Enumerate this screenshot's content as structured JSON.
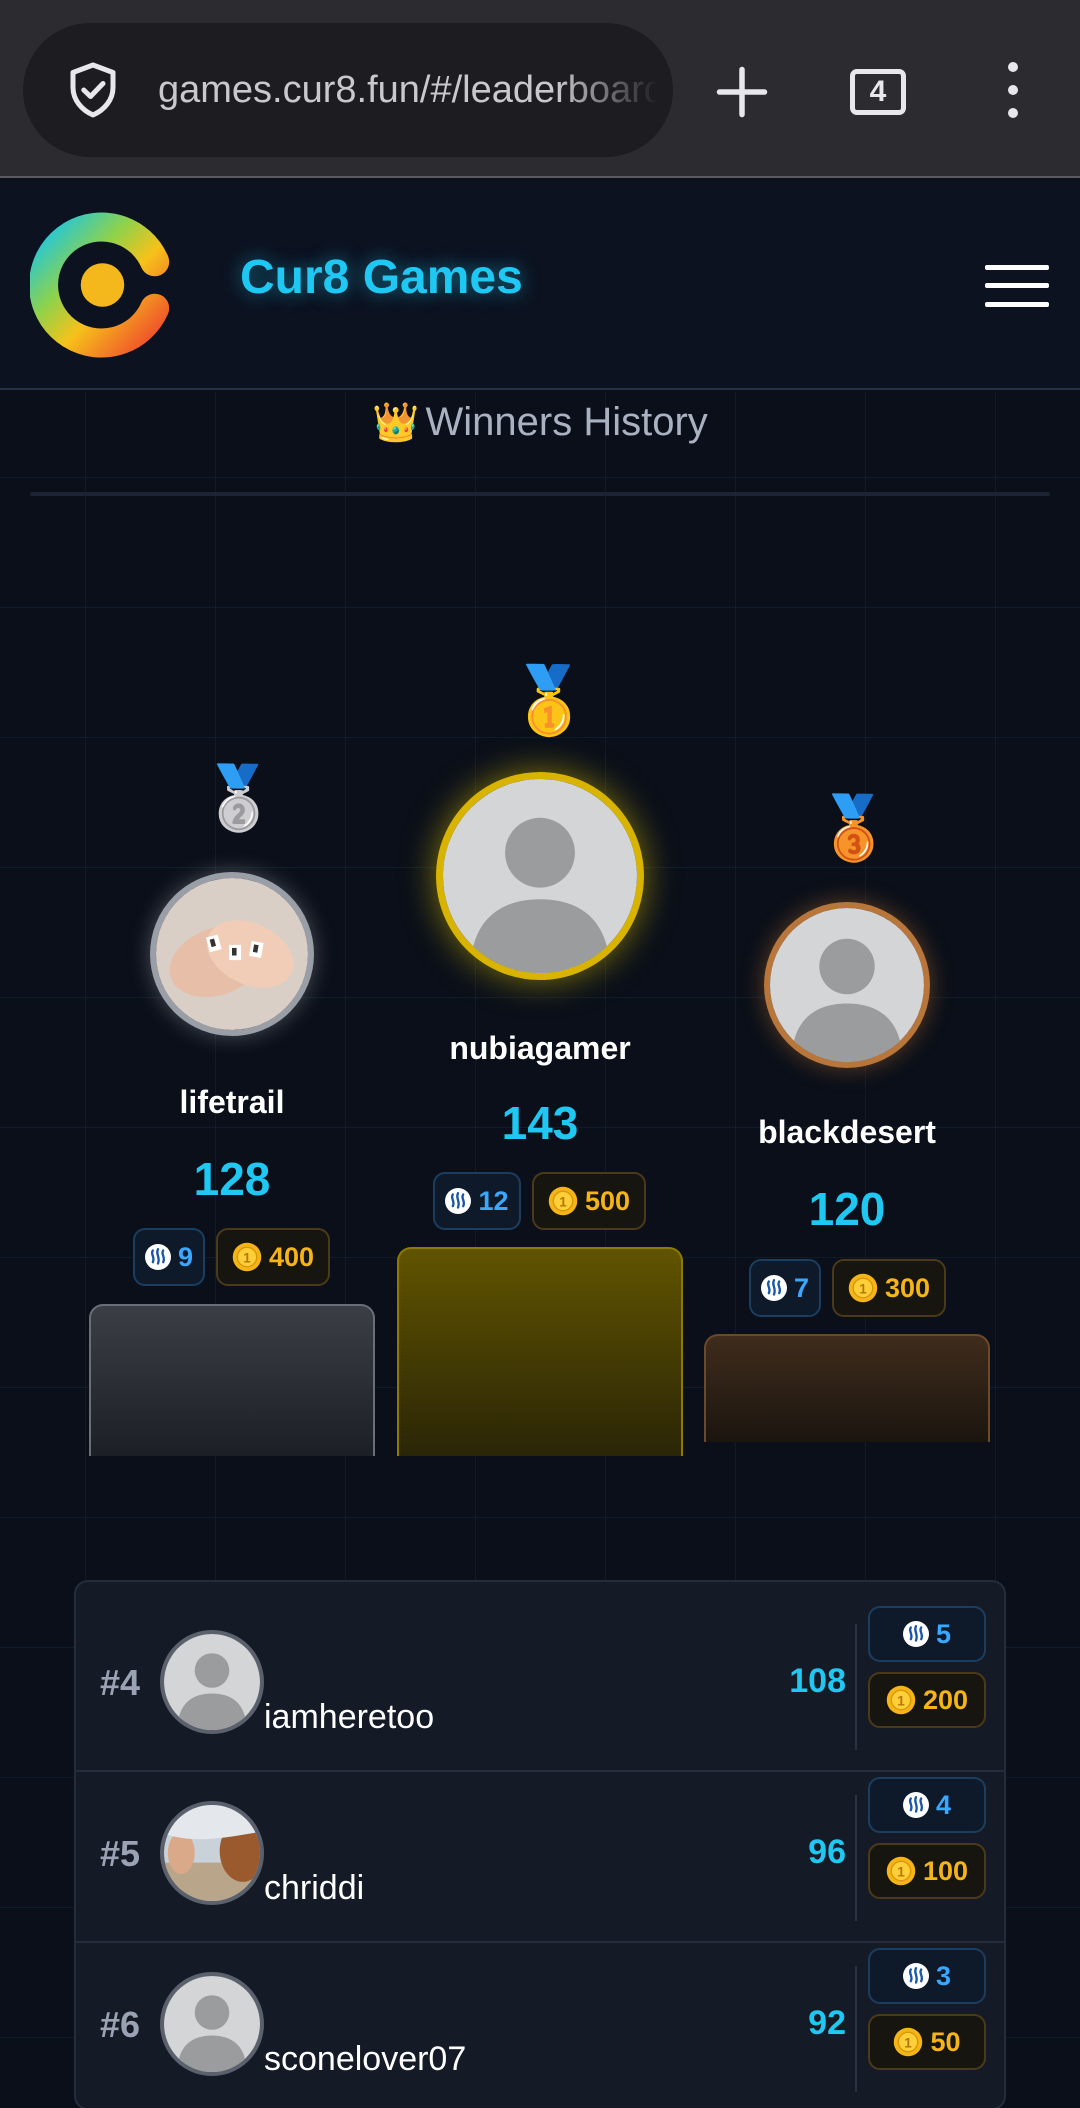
{
  "browser": {
    "url": "games.cur8.fun/#/leaderboard",
    "tab_count": "4"
  },
  "header": {
    "brand": "Cur8 Games"
  },
  "section": {
    "crown_icon": "👑",
    "title": "Winners History"
  },
  "podium": {
    "first": {
      "medal": "🥇",
      "name": "nubiagamer",
      "score": "143",
      "steem": "12",
      "coins": "500"
    },
    "second": {
      "medal": "🥈",
      "name": "lifetrail",
      "score": "128",
      "steem": "9",
      "coins": "400"
    },
    "third": {
      "medal": "🥉",
      "name": "blackdesert",
      "score": "120",
      "steem": "7",
      "coins": "300"
    }
  },
  "leaderboard": [
    {
      "rank": "#4",
      "name": "iamheretoo",
      "score": "108",
      "steem": "5",
      "coins": "200"
    },
    {
      "rank": "#5",
      "name": "chriddi",
      "score": "96",
      "steem": "4",
      "coins": "100"
    },
    {
      "rank": "#6",
      "name": "sconelover07",
      "score": "92",
      "steem": "3",
      "coins": "50"
    }
  ],
  "icons": {
    "steem": "steem-icon",
    "coin": "coin-icon"
  },
  "colors": {
    "accent": "#1fc8f2",
    "gold": "#d8b400",
    "silver": "#9a9ea6",
    "bronze": "#b8763a",
    "coin": "#f5b519",
    "steem": "#3aa8ff"
  }
}
